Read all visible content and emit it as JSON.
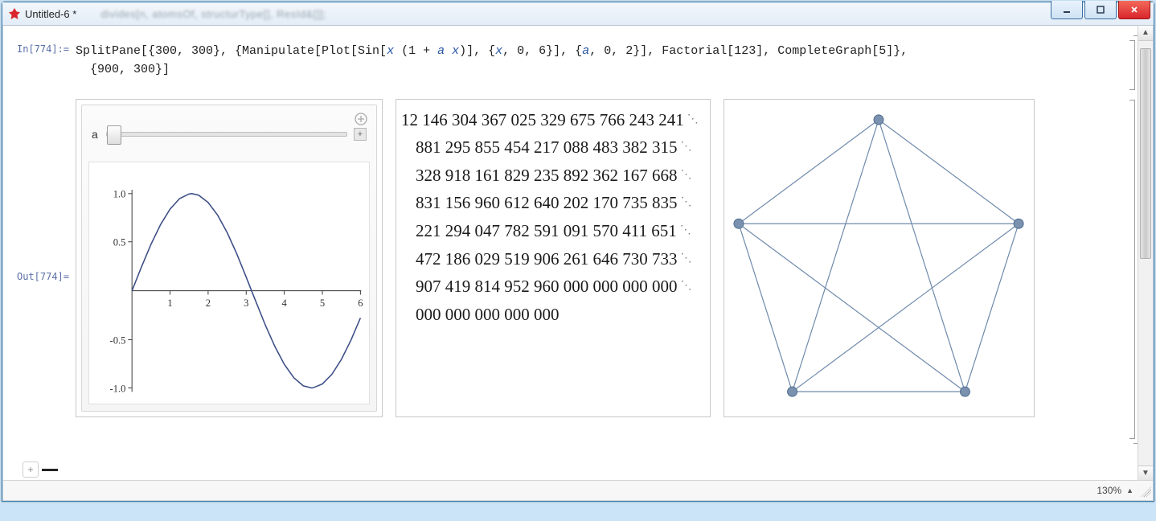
{
  "window": {
    "title": "Untitled-6 *",
    "blurred_toolbar_hint": "divides[n, atomsOf, structurType[], ResId&[]];"
  },
  "cell": {
    "in_label": "In[774]:=",
    "out_label": "Out[774]=",
    "code_line1_a": "SplitPane[{300, 300}, {Manipulate[Plot[Sin[",
    "code_sym_x1": "x",
    "code_line1_b": " (1 + ",
    "code_sym_ax": "a x",
    "code_line1_c": ")], {",
    "code_sym_x2": "x",
    "code_line1_d": ", 0, 6}], {",
    "code_sym_a": "a",
    "code_line1_e": ", 0, 2}], Factorial[123], CompleteGraph[5]},",
    "code_line2": "  {900, 300}]"
  },
  "manipulate": {
    "slider_variable": "a",
    "slider_min": 0,
    "slider_max": 2,
    "slider_value": 0
  },
  "chart_data": {
    "type": "line",
    "title": "",
    "xlabel": "",
    "ylabel": "",
    "xlim": [
      0,
      6
    ],
    "ylim": [
      -1.0,
      1.0
    ],
    "xticks": [
      1,
      2,
      3,
      4,
      5,
      6
    ],
    "yticks": [
      -1.0,
      -0.5,
      0.5,
      1.0
    ],
    "x": [
      0.0,
      0.25,
      0.5,
      0.75,
      1.0,
      1.25,
      1.5,
      1.5708,
      1.75,
      2.0,
      2.25,
      2.5,
      2.75,
      3.0,
      3.1416,
      3.25,
      3.5,
      3.75,
      4.0,
      4.25,
      4.5,
      4.7124,
      4.75,
      5.0,
      5.25,
      5.5,
      5.75,
      6.0
    ],
    "y": [
      0.0,
      0.247,
      0.479,
      0.682,
      0.841,
      0.949,
      0.997,
      1.0,
      0.984,
      0.909,
      0.778,
      0.599,
      0.382,
      0.141,
      0.0,
      -0.108,
      -0.351,
      -0.572,
      -0.757,
      -0.895,
      -0.978,
      -1.0,
      -0.999,
      -0.959,
      -0.859,
      -0.706,
      -0.508,
      -0.279
    ],
    "description": "Sin[x (1 + a x)] with a = 0 → Sin[x] over 0..6"
  },
  "factorial": {
    "description": "123! displayed with group-of-3 spacing and line-continuation marks",
    "lines": [
      "12 146 304 367 025 329 675 766 243 241",
      "881 295 855 454 217 088 483 382 315",
      "328 918 161 829 235 892 362 167 668",
      "831 156 960 612 640 202 170 735 835",
      "221 294 047 782 591 091 570 411 651",
      "472 186 029 519 906 261 646 730 733",
      "907 419 814 952 960 000 000 000 000",
      "000 000 000 000 000"
    ]
  },
  "graph": {
    "description": "CompleteGraph[5] — 5 vertices on a pentagon, all pairs connected",
    "vertex_count": 5,
    "edge_count": 10
  },
  "status": {
    "zoom": "130%"
  }
}
